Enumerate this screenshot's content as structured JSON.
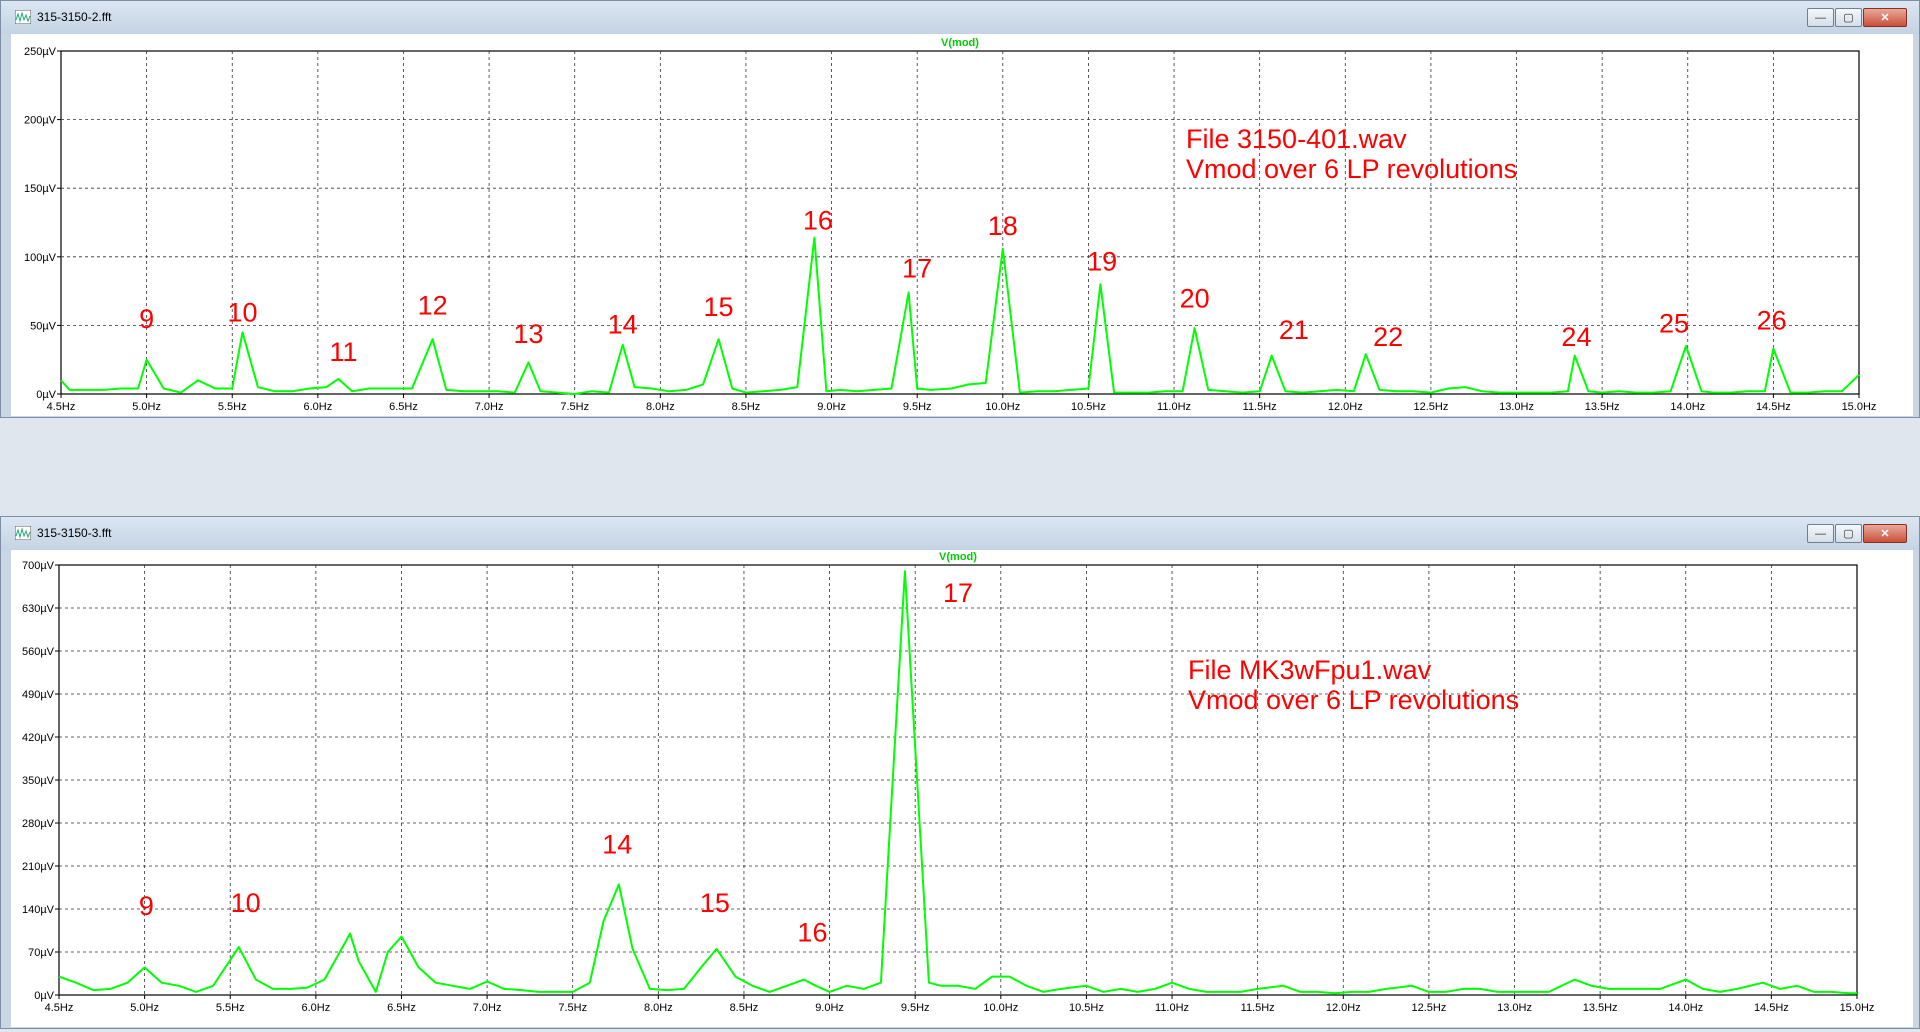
{
  "windows": [
    {
      "title": "315-3150-2.fft"
    },
    {
      "title": "315-3150-3.fft"
    }
  ],
  "window_buttons": {
    "minimize": "—",
    "restore": "▢",
    "close": "✕"
  },
  "chart_data": [
    {
      "type": "line",
      "title": "V(mod)",
      "xlabel": "",
      "ylabel": "",
      "xlim": [
        4.5,
        15.0
      ],
      "ylim": [
        0,
        250
      ],
      "xunit": "Hz",
      "yunit": "µV",
      "grid": true,
      "line_color": "#00ff00",
      "x_ticks": [
        "4.5Hz",
        "5.0Hz",
        "5.5Hz",
        "6.0Hz",
        "6.5Hz",
        "7.0Hz",
        "7.5Hz",
        "8.0Hz",
        "8.5Hz",
        "9.0Hz",
        "9.5Hz",
        "10.0Hz",
        "10.5Hz",
        "11.0Hz",
        "11.5Hz",
        "12.0Hz",
        "12.5Hz",
        "13.0Hz",
        "13.5Hz",
        "14.0Hz",
        "14.5Hz",
        "15.0Hz"
      ],
      "y_ticks": [
        "0µV",
        "50µV",
        "100µV",
        "150µV",
        "200µV",
        "250µV"
      ],
      "series": [
        {
          "x": [
            4.5,
            4.55,
            4.65,
            4.75,
            4.85,
            4.95,
            5.0,
            5.1,
            5.2,
            5.3,
            5.4,
            5.5,
            5.56,
            5.65,
            5.75,
            5.85,
            5.95,
            6.05,
            6.12,
            6.2,
            6.3,
            6.4,
            6.55,
            6.67,
            6.75,
            6.85,
            6.95,
            7.05,
            7.15,
            7.23,
            7.3,
            7.4,
            7.5,
            7.6,
            7.7,
            7.78,
            7.85,
            7.95,
            8.05,
            8.15,
            8.25,
            8.34,
            8.42,
            8.5,
            8.6,
            8.7,
            8.8,
            8.9,
            8.97,
            9.05,
            9.15,
            9.25,
            9.35,
            9.45,
            9.5,
            9.58,
            9.7,
            9.8,
            9.9,
            10.0,
            10.1,
            10.2,
            10.3,
            10.4,
            10.5,
            10.57,
            10.65,
            10.75,
            10.85,
            10.95,
            11.05,
            11.12,
            11.2,
            11.3,
            11.4,
            11.5,
            11.57,
            11.65,
            11.75,
            11.85,
            11.95,
            12.05,
            12.12,
            12.2,
            12.3,
            12.4,
            12.5,
            12.6,
            12.7,
            12.8,
            12.9,
            13.0,
            13.1,
            13.2,
            13.3,
            13.34,
            13.42,
            13.5,
            13.6,
            13.7,
            13.8,
            13.9,
            13.99,
            14.08,
            14.15,
            14.25,
            14.35,
            14.45,
            14.5,
            14.6,
            14.7,
            14.8,
            14.9,
            15.0
          ],
          "y": [
            10,
            3,
            3,
            3,
            4,
            4,
            25,
            4,
            1,
            10,
            4,
            4,
            45,
            5,
            2,
            2,
            4,
            5,
            11,
            2,
            4,
            4,
            4,
            40,
            3,
            2,
            2,
            2,
            1,
            23,
            2,
            1,
            0,
            2,
            1,
            36,
            5,
            4,
            2,
            3,
            7,
            40,
            4,
            1,
            2,
            3,
            5,
            114,
            2,
            3,
            2,
            3,
            4,
            74,
            4,
            3,
            4,
            7,
            8,
            106,
            1,
            2,
            2,
            3,
            4,
            80,
            1,
            1,
            1,
            2,
            2,
            48,
            3,
            2,
            1,
            2,
            28,
            2,
            1,
            2,
            3,
            2,
            29,
            3,
            2,
            2,
            1,
            4,
            5,
            2,
            1,
            1,
            1,
            1,
            2,
            28,
            2,
            1,
            2,
            1,
            1,
            2,
            35,
            2,
            1,
            1,
            2,
            2,
            33,
            1,
            1,
            2,
            2,
            14
          ]
        }
      ],
      "annotations": [
        {
          "text": "9",
          "x": 5.0,
          "y": 48
        },
        {
          "text": "10",
          "x": 5.56,
          "y": 53
        },
        {
          "text": "11",
          "x": 6.15,
          "y": 24
        },
        {
          "text": "12",
          "x": 6.67,
          "y": 58
        },
        {
          "text": "13",
          "x": 7.23,
          "y": 37
        },
        {
          "text": "14",
          "x": 7.78,
          "y": 44
        },
        {
          "text": "15",
          "x": 8.34,
          "y": 57
        },
        {
          "text": "16",
          "x": 8.92,
          "y": 120
        },
        {
          "text": "17",
          "x": 9.5,
          "y": 85
        },
        {
          "text": "18",
          "x": 10.0,
          "y": 116
        },
        {
          "text": "19",
          "x": 10.58,
          "y": 90
        },
        {
          "text": "20",
          "x": 11.12,
          "y": 63
        },
        {
          "text": "21",
          "x": 11.7,
          "y": 40
        },
        {
          "text": "22",
          "x": 12.25,
          "y": 35
        },
        {
          "text": "24",
          "x": 13.35,
          "y": 35
        },
        {
          "text": "25",
          "x": 13.92,
          "y": 45
        },
        {
          "text": "26",
          "x": 14.49,
          "y": 47
        }
      ],
      "notes": [
        "File 3150-401.wav",
        "Vmod over 6 LP revolutions"
      ]
    },
    {
      "type": "line",
      "title": "V(mod)",
      "xlabel": "",
      "ylabel": "",
      "xlim": [
        4.5,
        15.0
      ],
      "ylim": [
        0,
        700
      ],
      "xunit": "Hz",
      "yunit": "µV",
      "grid": true,
      "line_color": "#00ff00",
      "x_ticks": [
        "4.5Hz",
        "5.0Hz",
        "5.5Hz",
        "6.0Hz",
        "6.5Hz",
        "7.0Hz",
        "7.5Hz",
        "8.0Hz",
        "8.5Hz",
        "9.0Hz",
        "9.5Hz",
        "10.0Hz",
        "10.5Hz",
        "11.0Hz",
        "11.5Hz",
        "12.0Hz",
        "12.5Hz",
        "13.0Hz",
        "13.5Hz",
        "14.0Hz",
        "14.5Hz",
        "15.0Hz"
      ],
      "y_ticks": [
        "0µV",
        "70µV",
        "140µV",
        "210µV",
        "280µV",
        "350µV",
        "420µV",
        "490µV",
        "560µV",
        "630µV",
        "700µV"
      ],
      "series": [
        {
          "x": [
            4.5,
            4.6,
            4.7,
            4.8,
            4.9,
            5.0,
            5.1,
            5.2,
            5.3,
            5.4,
            5.55,
            5.65,
            5.75,
            5.85,
            5.95,
            6.05,
            6.2,
            6.25,
            6.35,
            6.42,
            6.5,
            6.6,
            6.7,
            6.8,
            6.9,
            7.0,
            7.1,
            7.2,
            7.3,
            7.4,
            7.5,
            7.6,
            7.68,
            7.77,
            7.85,
            7.95,
            8.05,
            8.15,
            8.25,
            8.34,
            8.45,
            8.55,
            8.65,
            8.75,
            8.85,
            8.92,
            9.0,
            9.1,
            9.2,
            9.3,
            9.44,
            9.58,
            9.65,
            9.75,
            9.85,
            9.95,
            10.05,
            10.15,
            10.25,
            10.35,
            10.5,
            10.6,
            10.7,
            10.8,
            10.9,
            11.0,
            11.1,
            11.2,
            11.3,
            11.4,
            11.5,
            11.65,
            11.75,
            11.85,
            11.95,
            12.05,
            12.15,
            12.25,
            12.4,
            12.5,
            12.6,
            12.7,
            12.8,
            12.9,
            13.0,
            13.1,
            13.2,
            13.35,
            13.45,
            13.55,
            13.65,
            13.75,
            13.85,
            14.0,
            14.1,
            14.2,
            14.3,
            14.45,
            14.55,
            14.65,
            14.75,
            14.85,
            14.95,
            15.0
          ],
          "y": [
            30,
            20,
            8,
            10,
            20,
            45,
            20,
            15,
            5,
            15,
            78,
            25,
            10,
            10,
            12,
            25,
            100,
            55,
            5,
            70,
            95,
            45,
            20,
            15,
            10,
            22,
            10,
            8,
            5,
            5,
            5,
            20,
            120,
            180,
            75,
            10,
            8,
            10,
            45,
            75,
            30,
            15,
            5,
            15,
            25,
            15,
            5,
            15,
            10,
            20,
            690,
            20,
            15,
            15,
            10,
            30,
            30,
            15,
            5,
            10,
            15,
            5,
            10,
            5,
            10,
            20,
            10,
            5,
            5,
            5,
            10,
            15,
            5,
            5,
            3,
            5,
            5,
            10,
            15,
            5,
            5,
            10,
            10,
            5,
            5,
            5,
            5,
            25,
            15,
            10,
            10,
            10,
            10,
            25,
            10,
            5,
            10,
            20,
            10,
            15,
            5,
            5,
            3,
            3
          ]
        }
      ],
      "annotations": [
        {
          "text": "9",
          "x": 5.01,
          "y": 130
        },
        {
          "text": "10",
          "x": 5.59,
          "y": 135
        },
        {
          "text": "14",
          "x": 7.76,
          "y": 230
        },
        {
          "text": "15",
          "x": 8.33,
          "y": 135
        },
        {
          "text": "16",
          "x": 8.9,
          "y": 87
        },
        {
          "text": "17",
          "x": 9.75,
          "y": 640
        }
      ],
      "notes": [
        "File MK3wFpu1.wav",
        "Vmod over 6 LP revolutions"
      ]
    }
  ]
}
